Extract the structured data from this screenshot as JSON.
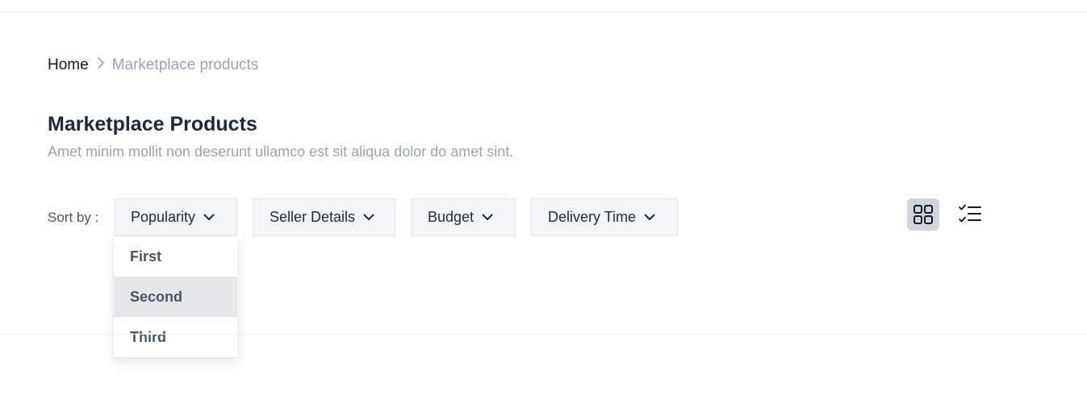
{
  "breadcrumb": {
    "home": "Home",
    "current": "Marketplace products"
  },
  "header": {
    "title": "Marketplace Products",
    "subtitle": "Amet minim mollit non deserunt ullamco est sit aliqua dolor do amet sint."
  },
  "sort": {
    "label": "Sort by :",
    "filters": [
      "Popularity",
      "Seller Details",
      "Budget",
      "Delivery Time"
    ],
    "open_dropdown": {
      "options": [
        "First",
        "Second",
        "Third"
      ],
      "highlighted": "Second"
    }
  },
  "view_toggle": {
    "options": [
      "grid-view-icon",
      "list-view-icon"
    ],
    "active": "grid-view-icon"
  },
  "colors": {
    "text_primary": "#111827",
    "text_muted": "#9ca3af",
    "filter_bg": "#f3f5f8",
    "highlight_bg": "#e5e7eb",
    "active_toggle_bg": "#d1d5db"
  }
}
